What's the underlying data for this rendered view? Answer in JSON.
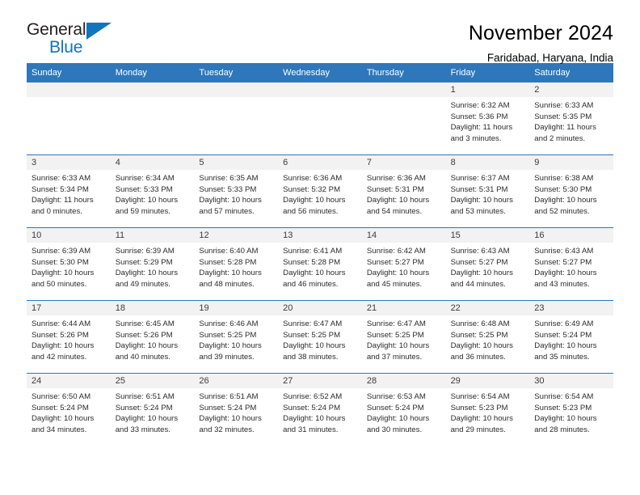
{
  "logo": {
    "word_one": "General",
    "word_two": "Blue",
    "triangle_color": "#1175bb",
    "icon": "triangle-icon"
  },
  "header": {
    "title": "November 2024",
    "subtitle": "Faridabad, Haryana, India"
  },
  "theme": {
    "header_blue": "#2e77bb",
    "day_band_gray": "#f2f2f2",
    "text_color": "#2b2b2b"
  },
  "weekdays": [
    "Sunday",
    "Monday",
    "Tuesday",
    "Wednesday",
    "Thursday",
    "Friday",
    "Saturday"
  ],
  "weeks": [
    [
      {
        "day": "",
        "empty": true
      },
      {
        "day": "",
        "empty": true
      },
      {
        "day": "",
        "empty": true
      },
      {
        "day": "",
        "empty": true
      },
      {
        "day": "",
        "empty": true
      },
      {
        "day": "1",
        "sunrise": "Sunrise: 6:32 AM",
        "sunset": "Sunset: 5:36 PM",
        "daylight": "Daylight: 11 hours and 3 minutes."
      },
      {
        "day": "2",
        "sunrise": "Sunrise: 6:33 AM",
        "sunset": "Sunset: 5:35 PM",
        "daylight": "Daylight: 11 hours and 2 minutes."
      }
    ],
    [
      {
        "day": "3",
        "sunrise": "Sunrise: 6:33 AM",
        "sunset": "Sunset: 5:34 PM",
        "daylight": "Daylight: 11 hours and 0 minutes."
      },
      {
        "day": "4",
        "sunrise": "Sunrise: 6:34 AM",
        "sunset": "Sunset: 5:33 PM",
        "daylight": "Daylight: 10 hours and 59 minutes."
      },
      {
        "day": "5",
        "sunrise": "Sunrise: 6:35 AM",
        "sunset": "Sunset: 5:33 PM",
        "daylight": "Daylight: 10 hours and 57 minutes."
      },
      {
        "day": "6",
        "sunrise": "Sunrise: 6:36 AM",
        "sunset": "Sunset: 5:32 PM",
        "daylight": "Daylight: 10 hours and 56 minutes."
      },
      {
        "day": "7",
        "sunrise": "Sunrise: 6:36 AM",
        "sunset": "Sunset: 5:31 PM",
        "daylight": "Daylight: 10 hours and 54 minutes."
      },
      {
        "day": "8",
        "sunrise": "Sunrise: 6:37 AM",
        "sunset": "Sunset: 5:31 PM",
        "daylight": "Daylight: 10 hours and 53 minutes."
      },
      {
        "day": "9",
        "sunrise": "Sunrise: 6:38 AM",
        "sunset": "Sunset: 5:30 PM",
        "daylight": "Daylight: 10 hours and 52 minutes."
      }
    ],
    [
      {
        "day": "10",
        "sunrise": "Sunrise: 6:39 AM",
        "sunset": "Sunset: 5:30 PM",
        "daylight": "Daylight: 10 hours and 50 minutes."
      },
      {
        "day": "11",
        "sunrise": "Sunrise: 6:39 AM",
        "sunset": "Sunset: 5:29 PM",
        "daylight": "Daylight: 10 hours and 49 minutes."
      },
      {
        "day": "12",
        "sunrise": "Sunrise: 6:40 AM",
        "sunset": "Sunset: 5:28 PM",
        "daylight": "Daylight: 10 hours and 48 minutes."
      },
      {
        "day": "13",
        "sunrise": "Sunrise: 6:41 AM",
        "sunset": "Sunset: 5:28 PM",
        "daylight": "Daylight: 10 hours and 46 minutes."
      },
      {
        "day": "14",
        "sunrise": "Sunrise: 6:42 AM",
        "sunset": "Sunset: 5:27 PM",
        "daylight": "Daylight: 10 hours and 45 minutes."
      },
      {
        "day": "15",
        "sunrise": "Sunrise: 6:43 AM",
        "sunset": "Sunset: 5:27 PM",
        "daylight": "Daylight: 10 hours and 44 minutes."
      },
      {
        "day": "16",
        "sunrise": "Sunrise: 6:43 AM",
        "sunset": "Sunset: 5:27 PM",
        "daylight": "Daylight: 10 hours and 43 minutes."
      }
    ],
    [
      {
        "day": "17",
        "sunrise": "Sunrise: 6:44 AM",
        "sunset": "Sunset: 5:26 PM",
        "daylight": "Daylight: 10 hours and 42 minutes."
      },
      {
        "day": "18",
        "sunrise": "Sunrise: 6:45 AM",
        "sunset": "Sunset: 5:26 PM",
        "daylight": "Daylight: 10 hours and 40 minutes."
      },
      {
        "day": "19",
        "sunrise": "Sunrise: 6:46 AM",
        "sunset": "Sunset: 5:25 PM",
        "daylight": "Daylight: 10 hours and 39 minutes."
      },
      {
        "day": "20",
        "sunrise": "Sunrise: 6:47 AM",
        "sunset": "Sunset: 5:25 PM",
        "daylight": "Daylight: 10 hours and 38 minutes."
      },
      {
        "day": "21",
        "sunrise": "Sunrise: 6:47 AM",
        "sunset": "Sunset: 5:25 PM",
        "daylight": "Daylight: 10 hours and 37 minutes."
      },
      {
        "day": "22",
        "sunrise": "Sunrise: 6:48 AM",
        "sunset": "Sunset: 5:25 PM",
        "daylight": "Daylight: 10 hours and 36 minutes."
      },
      {
        "day": "23",
        "sunrise": "Sunrise: 6:49 AM",
        "sunset": "Sunset: 5:24 PM",
        "daylight": "Daylight: 10 hours and 35 minutes."
      }
    ],
    [
      {
        "day": "24",
        "sunrise": "Sunrise: 6:50 AM",
        "sunset": "Sunset: 5:24 PM",
        "daylight": "Daylight: 10 hours and 34 minutes."
      },
      {
        "day": "25",
        "sunrise": "Sunrise: 6:51 AM",
        "sunset": "Sunset: 5:24 PM",
        "daylight": "Daylight: 10 hours and 33 minutes."
      },
      {
        "day": "26",
        "sunrise": "Sunrise: 6:51 AM",
        "sunset": "Sunset: 5:24 PM",
        "daylight": "Daylight: 10 hours and 32 minutes."
      },
      {
        "day": "27",
        "sunrise": "Sunrise: 6:52 AM",
        "sunset": "Sunset: 5:24 PM",
        "daylight": "Daylight: 10 hours and 31 minutes."
      },
      {
        "day": "28",
        "sunrise": "Sunrise: 6:53 AM",
        "sunset": "Sunset: 5:24 PM",
        "daylight": "Daylight: 10 hours and 30 minutes."
      },
      {
        "day": "29",
        "sunrise": "Sunrise: 6:54 AM",
        "sunset": "Sunset: 5:23 PM",
        "daylight": "Daylight: 10 hours and 29 minutes."
      },
      {
        "day": "30",
        "sunrise": "Sunrise: 6:54 AM",
        "sunset": "Sunset: 5:23 PM",
        "daylight": "Daylight: 10 hours and 28 minutes."
      }
    ]
  ]
}
